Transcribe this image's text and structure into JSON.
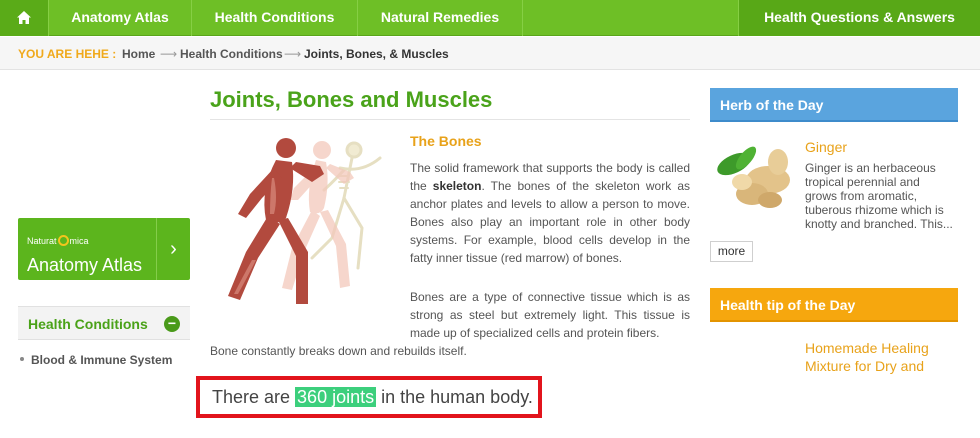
{
  "nav": {
    "home_icon": "home-icon",
    "items": [
      "Anatomy Atlas",
      "Health Conditions",
      "Natural Remedies"
    ],
    "right_item": "Health Questions & Answers"
  },
  "breadcrumb": {
    "label": "YOU ARE HEHE :",
    "items": [
      "Home",
      "Health Conditions",
      "Joints, Bones, & Muscles"
    ],
    "separator": "⟶"
  },
  "left_sidebar": {
    "atlas_card": {
      "brand_prefix": "Naturat",
      "brand_suffix": "mica",
      "title": "Anatomy Atlas",
      "chevron": "›"
    },
    "health_conditions": {
      "label": "Health Conditions",
      "toggle": "−"
    },
    "list": [
      "Blood & Immune System"
    ]
  },
  "main": {
    "title": "Joints, Bones and Muscles",
    "section_title": "The Bones",
    "para1_part1": "The solid framework that supports the body is called the ",
    "para1_bold": "skeleton",
    "para1_part2": ".  The bones of the skeleton work as anchor plates and levels to allow a person to move.  Bones also play an important role in other body systems.  For example, blood cells develop in the fatty inner tissue (red marrow) of bones.",
    "para2_a": "Bones are a type of connective tissue which is as strong as steel but extremely light.  This tissue is made up of specialized cells and protein fibers.",
    "para2_b": "Bone constantly breaks down and rebuilds itself.",
    "fact_before": "There are ",
    "fact_highlight": "360 joints",
    "fact_after": " in the human body."
  },
  "right_sidebar": {
    "herb_header": "Herb of the Day",
    "herb_name": "Ginger",
    "herb_desc": "Ginger is an herbaceous tropical perennial and grows from aromatic, tuberous rhizome which is knotty and branched. This...",
    "more_label": "more",
    "tip_header": "Health tip of the Day",
    "tip_title": "Homemade Healing Mixture for Dry and"
  },
  "colors": {
    "nav_green": "#6ebf26",
    "title_green": "#4aa31a",
    "accent_orange": "#e8a21a",
    "herb_blue": "#5aa4de",
    "tip_orange": "#f6a70e",
    "highlight_green": "#3ccf7c",
    "callout_red": "#e2141c"
  }
}
